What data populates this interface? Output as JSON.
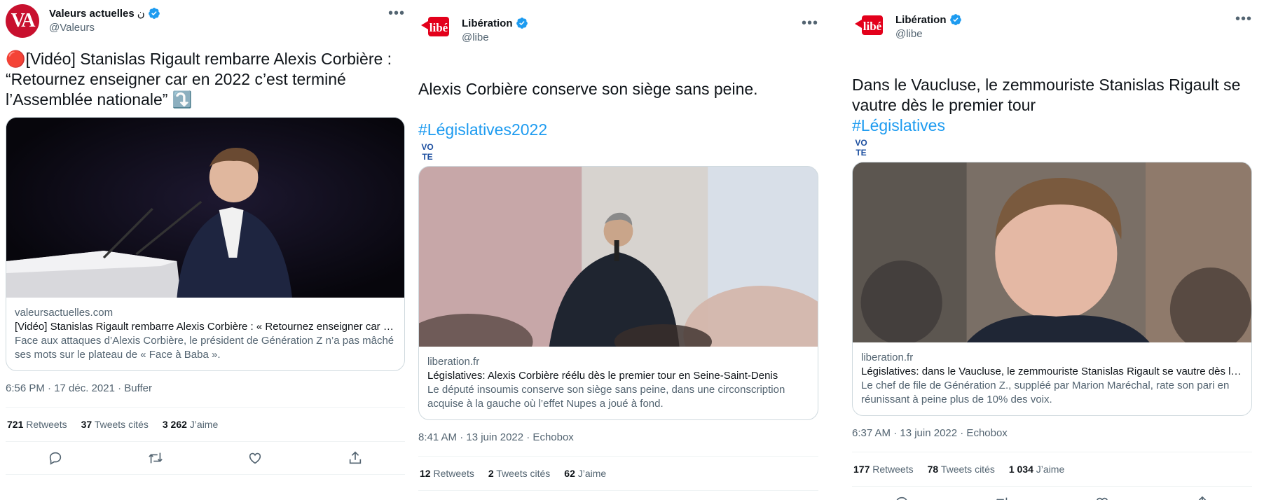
{
  "tweets": [
    {
      "name": "Valeurs actuelles",
      "name_suffix": "ن",
      "handle": "@Valeurs",
      "avatar_text": "VA",
      "text": "🔴[Vidéo] Stanislas Rigault rembarre Alexis Corbière :\n“Retournez enseigner car en 2022 c’est terminé\nl’Assemblée nationale” ⤵️",
      "hashtag": "",
      "card": {
        "domain": "valeursactuelles.com",
        "title": "[Vidéo] Stanislas Rigault rembarre Alexis Corbière : « Retournez enseigner car en 2022 c’est terminé l’Assemblée nationale »",
        "desc": "Face aux attaques d’Alexis Corbière, le président de Génération Z n’a pas mâché ses mots sur le plateau de « Face à Baba »."
      },
      "time": "6:56 PM · 17 déc. 2021 · Buffer",
      "stats": [
        {
          "num": "721",
          "label": "Retweets"
        },
        {
          "num": "37",
          "label": "Tweets cités"
        },
        {
          "num": "3 262",
          "label": "J’aime"
        }
      ]
    },
    {
      "name": "Libération",
      "name_suffix": "",
      "handle": "@libe",
      "avatar_text": "libé",
      "text": "Alexis Corbière conserve son siège sans peine.",
      "hashtag": "#Législatives2022",
      "card": {
        "domain": "liberation.fr",
        "title": "Législatives: Alexis Corbière réélu dès le premier tour en Seine-Saint-Denis",
        "desc": "Le député insoumis conserve son siège sans peine, dans une circonscription acquise à la gauche où l’effet Nupes a joué à fond."
      },
      "time": "8:41 AM · 13 juin 2022 · Echobox",
      "stats": [
        {
          "num": "12",
          "label": "Retweets"
        },
        {
          "num": "2",
          "label": "Tweets cités"
        },
        {
          "num": "62",
          "label": "J’aime"
        }
      ]
    },
    {
      "name": "Libération",
      "name_suffix": "",
      "handle": "@libe",
      "avatar_text": "libé",
      "text": "Dans le Vaucluse, le zemmouriste Stanislas Rigault se\nvautre dès le premier tour",
      "hashtag": "#Législatives",
      "card": {
        "domain": "liberation.fr",
        "title": "Législatives: dans le Vaucluse, le zemmouriste Stanislas Rigault se vautre dès le premier tour",
        "desc": "Le chef de file de Génération Z., suppléé par Marion Maréchal, rate son pari en réunissant à peine plus de 10% des voix."
      },
      "time": "6:37 AM · 13 juin 2022 · Echobox",
      "stats": [
        {
          "num": "177",
          "label": "Retweets"
        },
        {
          "num": "78",
          "label": "Tweets cités"
        },
        {
          "num": "1 034",
          "label": "J’aime"
        }
      ]
    }
  ],
  "vote_badge": {
    "top": "VO",
    "bottom": "TE"
  },
  "icons": [
    "verified-icon",
    "more-icon",
    "reply-icon",
    "retweet-icon",
    "like-icon",
    "share-icon",
    "vote-badge-icon"
  ],
  "colors": {
    "link": "#1d9bf0",
    "text": "#0f1419",
    "muted": "#536471",
    "border": "#cfd9de",
    "va_red": "#c8102e",
    "libe_red": "#e3001b"
  }
}
